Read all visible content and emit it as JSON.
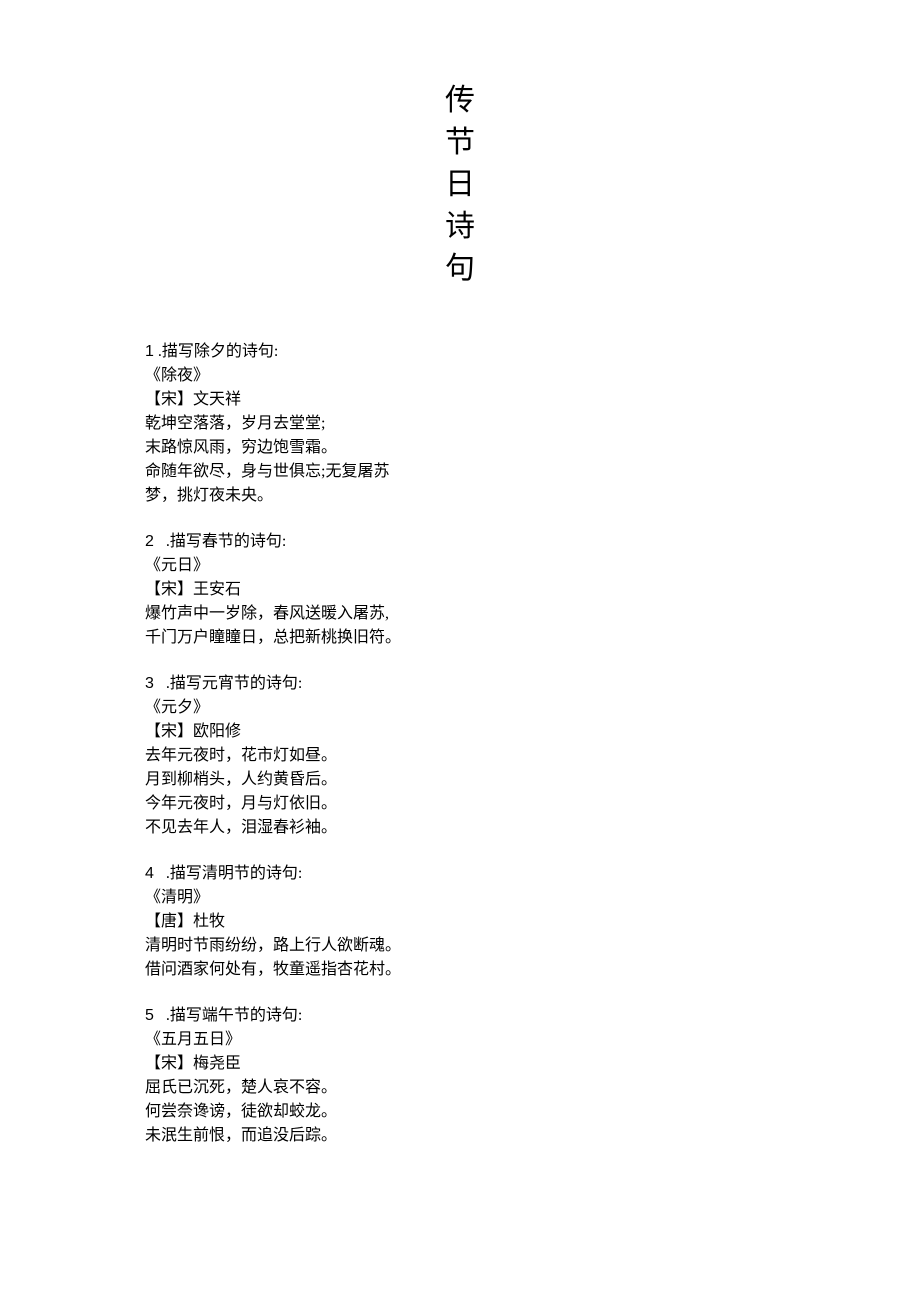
{
  "title_chars": [
    "传",
    "节",
    "日",
    "诗",
    "句"
  ],
  "sections": [
    {
      "num": "1",
      "heading_rest": " .描写除夕的诗句:",
      "lines": [
        "《除夜》",
        "【宋】文天祥",
        "乾坤空落落，岁月去堂堂;",
        "末路惊风雨，穷边饱雪霜。",
        "命随年欲尽，身与世俱忘;无复屠苏",
        "梦，挑灯夜未央。"
      ]
    },
    {
      "num": "2",
      "heading_rest": "   .描写春节的诗句:",
      "lines": [
        "《元日》",
        "【宋】王安石",
        "爆竹声中一岁除，春风送暖入屠苏,",
        "千门万户瞳瞳日，总把新桃换旧符。"
      ]
    },
    {
      "num": "3",
      "heading_rest": "   .描写元宵节的诗句:",
      "lines": [
        "《元夕》",
        "【宋】欧阳修",
        "去年元夜时，花市灯如昼。",
        "月到柳梢头，人约黄昏后。",
        "今年元夜时，月与灯依旧。",
        "不见去年人，泪湿春衫袖。"
      ]
    },
    {
      "num": "4",
      "heading_rest": "   .描写清明节的诗句:",
      "lines": [
        "《清明》",
        "【唐】杜牧",
        "清明时节雨纷纷，路上行人欲断魂。",
        "借问酒家何处有，牧童遥指杏花村。"
      ]
    },
    {
      "num": "5",
      "heading_rest": "   .描写端午节的诗句:",
      "lines": [
        "《五月五日》",
        "【宋】梅尧臣",
        "屈氏已沉死，楚人哀不容。",
        "何尝奈谗谤，徒欲却蛟龙。",
        "未泯生前恨，而追没后踪。"
      ]
    }
  ]
}
